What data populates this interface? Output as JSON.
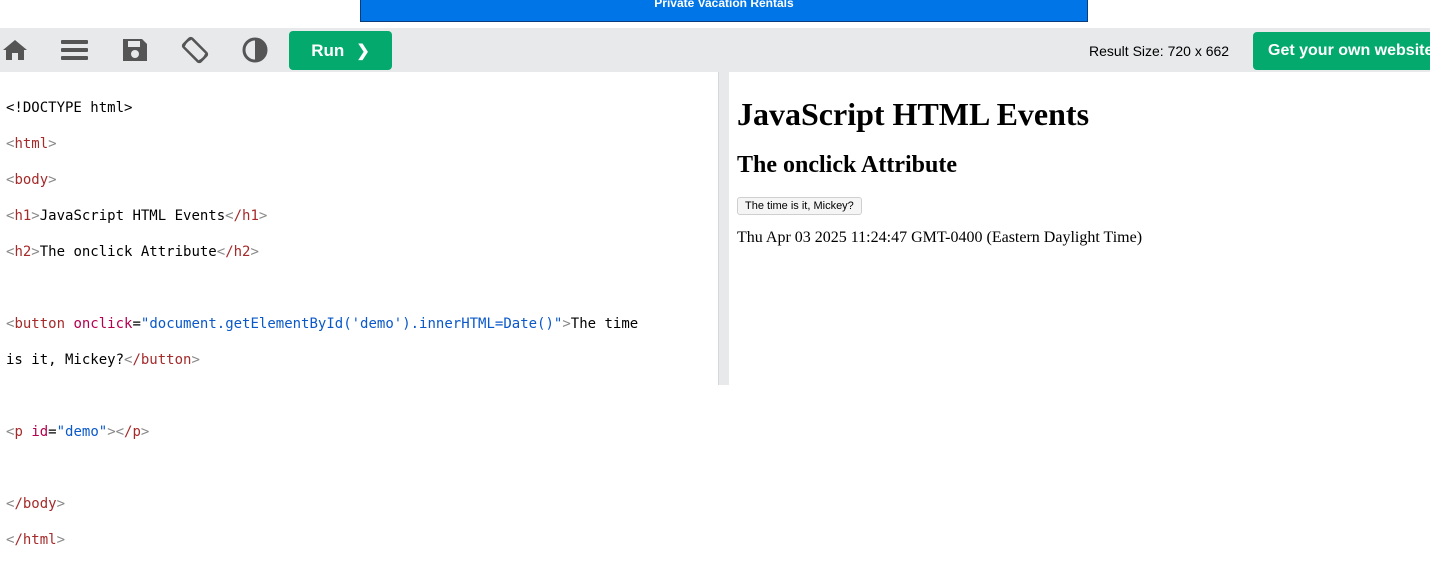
{
  "banner": {
    "text": "Private Vacation Rentals"
  },
  "toolbar": {
    "run_label": "Run",
    "run_chevron": "❯",
    "result_size": "Result Size: 720 x 662",
    "get_website": "Get your own website"
  },
  "colors": {
    "accent": "#04aa6d",
    "banner": "#0075e8",
    "toolbar_bg": "#e7e9eb"
  },
  "icons": [
    "home-icon",
    "menu-icon",
    "save-icon",
    "rotate-icon",
    "theme-contrast-icon"
  ],
  "editor": {
    "l1": "<!DOCTYPE html>",
    "html_open": "html",
    "body_open": "body",
    "h1_open": "h1",
    "h1_text": "JavaScript HTML Events",
    "h1_close": "/h1",
    "h2_open": "h2",
    "h2_text": "The onclick Attribute",
    "h2_close": "/h2",
    "button_open": "button",
    "onclick_attr": "onclick",
    "onclick_val": "\"document.getElementById('demo').innerHTML=Date()\"",
    "button_text_a": "The time",
    "button_text_b": "is it, Mickey?",
    "button_close": "/button",
    "p_open": "p",
    "id_attr": "id",
    "id_val": "\"demo\"",
    "p_close": "/p",
    "body_close": "/body",
    "html_close": "/html"
  },
  "result": {
    "heading": "JavaScript HTML Events",
    "subheading": "The onclick Attribute",
    "button_label": "The time is it, Mickey?",
    "date_output": "Thu Apr 03 2025 11:24:47 GMT-0400 (Eastern Daylight Time)"
  }
}
